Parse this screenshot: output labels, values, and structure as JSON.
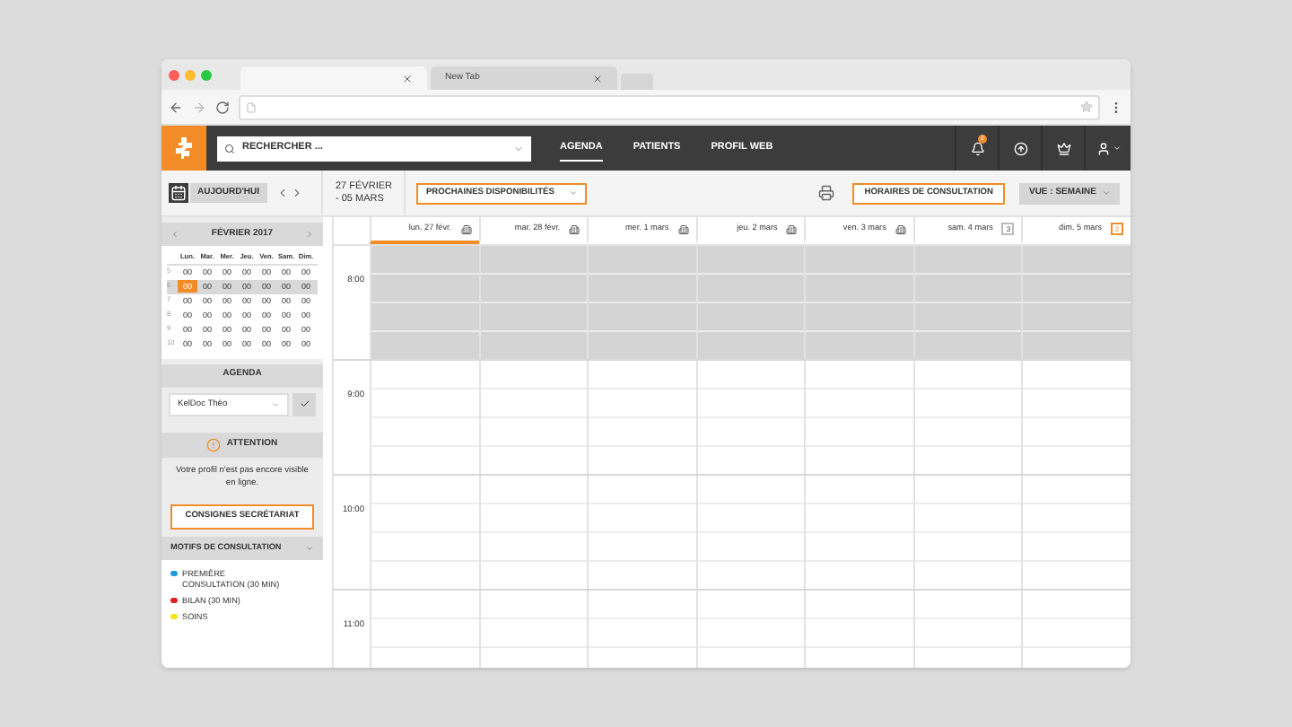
{
  "browser": {
    "tabs": [
      {
        "selected": true
      },
      {
        "label": "New Tab",
        "selected": false
      }
    ]
  },
  "nav": {
    "search": {
      "placeholder": "RECHERCHER ..."
    },
    "links": [
      {
        "label": "AGENDA",
        "selected": true
      },
      {
        "label": "PATIENTS",
        "selected": false
      },
      {
        "label": "PROFIL WEB",
        "selected": false
      }
    ],
    "notifications_badge": "2"
  },
  "toolbar": {
    "today": "AUJOURD'HUI",
    "range": [
      "27 FÉVRIER",
      "- 05 MARS"
    ],
    "availability": "PROCHAINES DISPONIBILITÉS",
    "hours_button": "HORAIRES DE CONSULTATION",
    "view": "VUE : SEMAINE"
  },
  "sidebar": {
    "month": "FÉVRIER 2017",
    "weekdays": [
      "Lun.",
      "Mar.",
      "Mer.",
      "Jeu.",
      "Ven.",
      "Sam.",
      "Dim."
    ],
    "weeks": [
      {
        "number": "5",
        "current": false,
        "days": [
          {
            "label": "00",
            "selected": false
          },
          {
            "label": "00",
            "selected": false
          },
          {
            "label": "00",
            "selected": false
          },
          {
            "label": "00",
            "selected": false
          },
          {
            "label": "00",
            "selected": false
          },
          {
            "label": "00",
            "selected": false
          },
          {
            "label": "00",
            "selected": false
          }
        ]
      },
      {
        "number": "6",
        "current": true,
        "days": [
          {
            "label": "00",
            "selected": true
          },
          {
            "label": "00",
            "selected": false
          },
          {
            "label": "00",
            "selected": false
          },
          {
            "label": "00",
            "selected": false
          },
          {
            "label": "00",
            "selected": false
          },
          {
            "label": "00",
            "selected": false
          },
          {
            "label": "00",
            "selected": false
          }
        ]
      },
      {
        "number": "7",
        "current": false,
        "days": [
          {
            "label": "00",
            "selected": false
          },
          {
            "label": "00",
            "selected": false
          },
          {
            "label": "00",
            "selected": false
          },
          {
            "label": "00",
            "selected": false
          },
          {
            "label": "00",
            "selected": false
          },
          {
            "label": "00",
            "selected": false
          },
          {
            "label": "00",
            "selected": false
          }
        ]
      },
      {
        "number": "8",
        "current": false,
        "days": [
          {
            "label": "00",
            "selected": false
          },
          {
            "label": "00",
            "selected": false
          },
          {
            "label": "00",
            "selected": false
          },
          {
            "label": "00",
            "selected": false
          },
          {
            "label": "00",
            "selected": false
          },
          {
            "label": "00",
            "selected": false
          },
          {
            "label": "00",
            "selected": false
          }
        ]
      },
      {
        "number": "9",
        "current": false,
        "days": [
          {
            "label": "00",
            "selected": false
          },
          {
            "label": "00",
            "selected": false
          },
          {
            "label": "00",
            "selected": false
          },
          {
            "label": "00",
            "selected": false
          },
          {
            "label": "00",
            "selected": false
          },
          {
            "label": "00",
            "selected": false
          },
          {
            "label": "00",
            "selected": false
          }
        ]
      },
      {
        "number": "10",
        "current": false,
        "days": [
          {
            "label": "00",
            "selected": false
          },
          {
            "label": "00",
            "selected": false
          },
          {
            "label": "00",
            "selected": false
          },
          {
            "label": "00",
            "selected": false
          },
          {
            "label": "00",
            "selected": false
          },
          {
            "label": "00",
            "selected": false
          },
          {
            "label": "00",
            "selected": false
          }
        ]
      }
    ],
    "agenda_title": "AGENDA",
    "agenda_select": "KelDoc Théo",
    "attention_title": "ATTENTION",
    "attention_text": "Votre profil n'est pas encore visible en ligne.",
    "instructions_button": "CONSIGNES SECRÉTARIAT",
    "reasons_title": "MOTIFS DE CONSULTATION",
    "reasons": [
      {
        "label": "PREMIÈRE CONSULTATION (30 MIN)",
        "color": "#1e9be0"
      },
      {
        "label": "BILAN (30 MIN)",
        "color": "#e0201e"
      },
      {
        "label": "SOINS",
        "color": "#f2e21b"
      }
    ]
  },
  "calendar": {
    "days": [
      {
        "label": "lun. 27 févr.",
        "selected": true,
        "kind": "icon"
      },
      {
        "label": "mar. 28 févr.",
        "selected": false,
        "kind": "icon"
      },
      {
        "label": "mer. 1 mars",
        "selected": false,
        "kind": "icon"
      },
      {
        "label": "jeu. 2 mars",
        "selected": false,
        "kind": "icon"
      },
      {
        "label": "ven. 3 mars",
        "selected": false,
        "kind": "icon"
      },
      {
        "label": "sam. 4 mars",
        "selected": false,
        "kind": "badge",
        "badge": "3",
        "highlight": false
      },
      {
        "label": "dim. 5 mars",
        "selected": false,
        "kind": "badge",
        "badge": "2",
        "highlight": true
      }
    ],
    "hours": [
      {
        "label": "8:00",
        "closed": true
      },
      {
        "label": "9:00",
        "closed": false
      },
      {
        "label": "10:00",
        "closed": false
      },
      {
        "label": "11:00",
        "closed": false
      }
    ]
  }
}
